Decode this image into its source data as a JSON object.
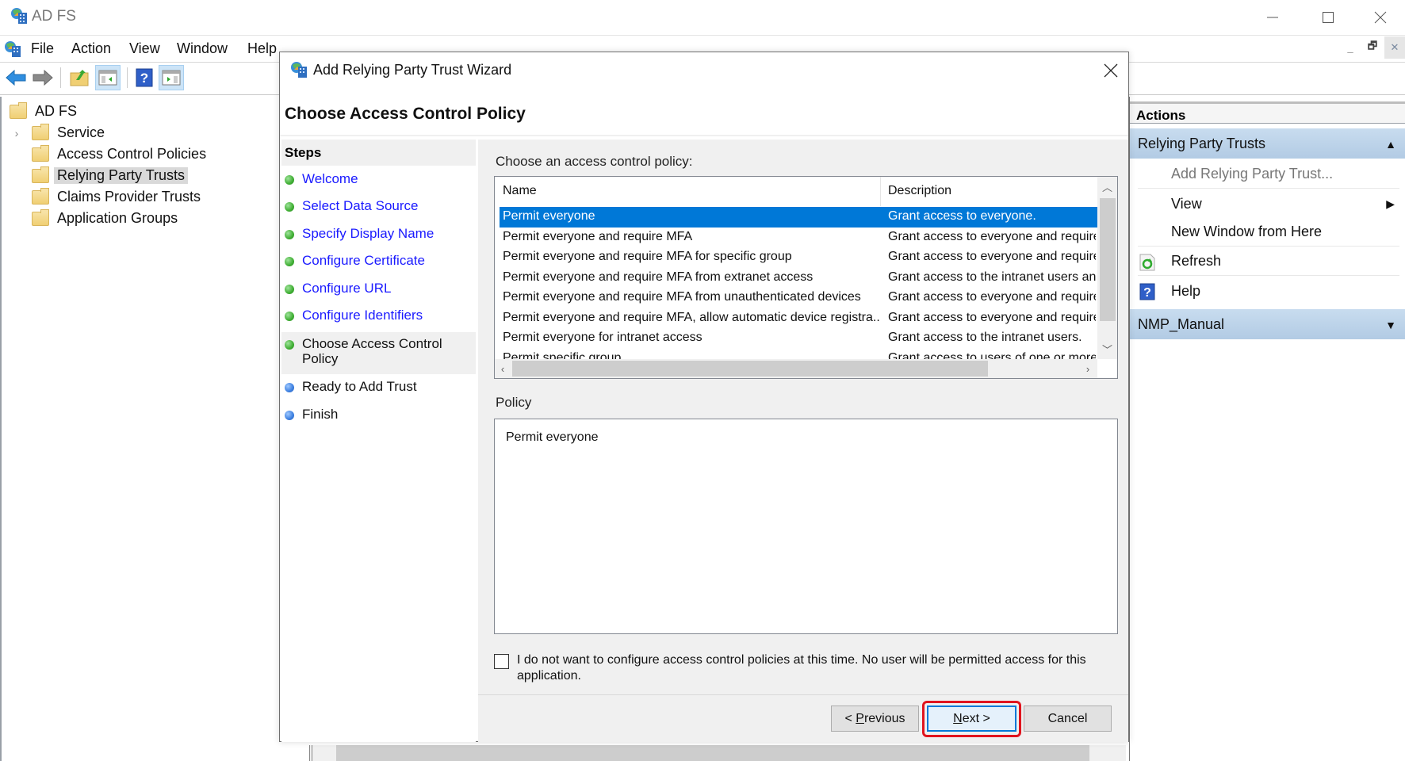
{
  "window": {
    "title": "AD FS",
    "controls": {
      "minimize": "minimize",
      "maximize": "maximize",
      "close": "close"
    }
  },
  "menubar": {
    "items": [
      "File",
      "Action",
      "View",
      "Window",
      "Help"
    ]
  },
  "toolbar": {
    "buttons": [
      "back-icon",
      "forward-icon",
      "up-folder-icon",
      "show-hide-tree-icon",
      "help-icon",
      "show-hide-action-pane-icon"
    ]
  },
  "tree": {
    "root": "AD FS",
    "items": [
      {
        "label": "Service",
        "expandable": true,
        "selected": false
      },
      {
        "label": "Access Control Policies",
        "expandable": false,
        "selected": false
      },
      {
        "label": "Relying Party Trusts",
        "expandable": false,
        "selected": true
      },
      {
        "label": "Claims Provider Trusts",
        "expandable": false,
        "selected": false
      },
      {
        "label": "Application Groups",
        "expandable": false,
        "selected": false
      }
    ]
  },
  "actions": {
    "header": "Actions",
    "groups": [
      {
        "title": "Relying Party Trusts",
        "expanded": true,
        "items": [
          {
            "label": "Add Relying Party Trust...",
            "disabled": true
          },
          {
            "label": "View",
            "submenu": true
          },
          {
            "label": "New Window from Here"
          },
          {
            "label": "Refresh",
            "icon": "refresh-icon"
          },
          {
            "label": "Help",
            "icon": "help-icon"
          }
        ]
      },
      {
        "title": "NMP_Manual",
        "expanded": false
      }
    ]
  },
  "wizard": {
    "title": "Add Relying Party Trust Wizard",
    "heading": "Choose Access Control Policy",
    "steps_header": "Steps",
    "steps": [
      {
        "label": "Welcome",
        "state": "done"
      },
      {
        "label": "Select Data Source",
        "state": "done"
      },
      {
        "label": "Specify Display Name",
        "state": "done"
      },
      {
        "label": "Configure Certificate",
        "state": "done"
      },
      {
        "label": "Configure URL",
        "state": "done"
      },
      {
        "label": "Configure Identifiers",
        "state": "done"
      },
      {
        "label": "Choose Access Control Policy",
        "state": "current"
      },
      {
        "label": "Ready to Add Trust",
        "state": "todo"
      },
      {
        "label": "Finish",
        "state": "todo"
      }
    ],
    "choose_label": "Choose an access control policy:",
    "columns": [
      "Name",
      "Description"
    ],
    "policies": [
      {
        "name": "Permit everyone",
        "description": "Grant access to everyone.",
        "selected": true
      },
      {
        "name": "Permit everyone and require MFA",
        "description": "Grant access to everyone and require"
      },
      {
        "name": "Permit everyone and require MFA for specific group",
        "description": "Grant access to everyone and require"
      },
      {
        "name": "Permit everyone and require MFA from extranet access",
        "description": "Grant access to the intranet users an"
      },
      {
        "name": "Permit everyone and require MFA from unauthenticated devices",
        "description": "Grant access to everyone and require"
      },
      {
        "name": "Permit everyone and require MFA, allow automatic device registra...",
        "description": "Grant access to everyone and require"
      },
      {
        "name": "Permit everyone for intranet access",
        "description": "Grant access to the intranet users."
      },
      {
        "name": "Permit specific group",
        "description": "Grant access to users of one or more"
      }
    ],
    "policy_label": "Policy",
    "policy_text": "Permit everyone",
    "no_config_checkbox": {
      "label": "I do not want to configure access control policies at this time. No user will be permitted access for this application.",
      "checked": false
    },
    "buttons": {
      "previous": {
        "prefix": "< ",
        "accel": "P",
        "rest": "revious"
      },
      "next": {
        "accel": "N",
        "rest": "ext >"
      },
      "cancel": "Cancel"
    },
    "highlight_color": "#e0141e",
    "selection_color": "#0078d7"
  }
}
